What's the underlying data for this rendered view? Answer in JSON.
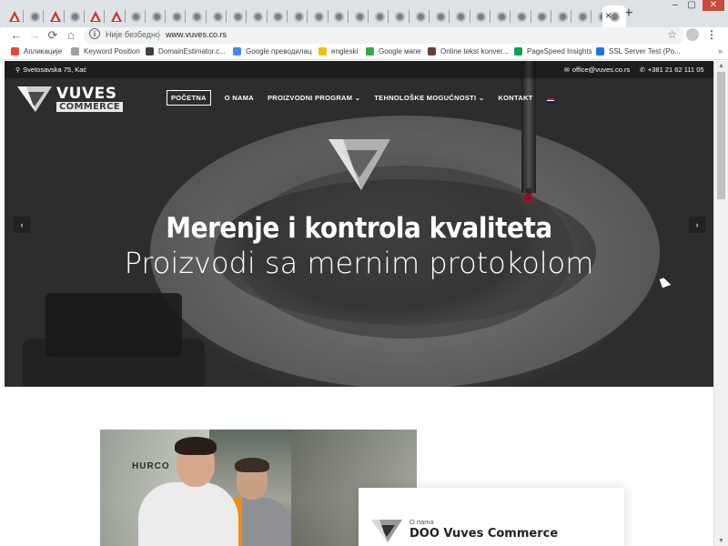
{
  "browser": {
    "tab_count": 30,
    "new_tab_label": "+",
    "close_tab": "×",
    "window_controls": [
      "–",
      "▢",
      "✕"
    ],
    "nav": {
      "back": "←",
      "forward": "→",
      "reload": "⟳",
      "home": "⌂"
    },
    "omnibox": {
      "security": "Није безбедно",
      "url": "www.vuves.co.rs"
    },
    "bookmarks": [
      {
        "label": "Апликације",
        "icon": "apps-grid-icon",
        "color": "#e8453c"
      },
      {
        "label": "Keyword Position",
        "icon": "seo-icon",
        "color": "#9aa0a6"
      },
      {
        "label": "DomainEstimator.c...",
        "icon": "globe-icon",
        "color": "#3c4043"
      },
      {
        "label": "Google преводилац",
        "icon": "translate-icon",
        "color": "#4285f4"
      },
      {
        "label": "engleski",
        "icon": "folder-icon",
        "color": "#f4c20d"
      },
      {
        "label": "Google мапе",
        "icon": "maps-icon",
        "color": "#34a853"
      },
      {
        "label": "Online tekst konver...",
        "icon": "circle-icon",
        "color": "#5d4037"
      },
      {
        "label": "PageSpeed Insights",
        "icon": "pagespeed-icon",
        "color": "#0f9d58"
      },
      {
        "label": "SSL Server Test (Po...",
        "icon": "ssl-icon",
        "color": "#1a73e8"
      }
    ],
    "bookmarks_more": "»"
  },
  "site": {
    "topbar": {
      "address": "Svetosavska 75, Kać",
      "email": "office@vuves.co.rs",
      "phone": "+381 21 62 111 05"
    },
    "logo": {
      "name": "VUVES",
      "sub": "COMMERCE"
    },
    "nav": [
      {
        "label": "POČETNA",
        "active": true
      },
      {
        "label": "O NAMA",
        "active": false
      },
      {
        "label": "PROIZVODNI PROGRAM ⌄",
        "active": false
      },
      {
        "label": "TEHNOLOŠKE MOGUĆNOSTI ⌄",
        "active": false
      },
      {
        "label": "KONTAKT",
        "active": false
      }
    ],
    "hero": {
      "title": "Merenje i kontrola kvaliteta",
      "subtitle": "Proizvodi sa mernim protokolom",
      "prev": "‹",
      "next": "›"
    },
    "about": {
      "image_label": "HURCO",
      "small": "O nama",
      "title": "DOO Vuves Commerce"
    }
  },
  "colors": {
    "accent": "#c0152a",
    "tabstrip": "#dee1e6",
    "hero_dark": "#2c2c2c"
  }
}
